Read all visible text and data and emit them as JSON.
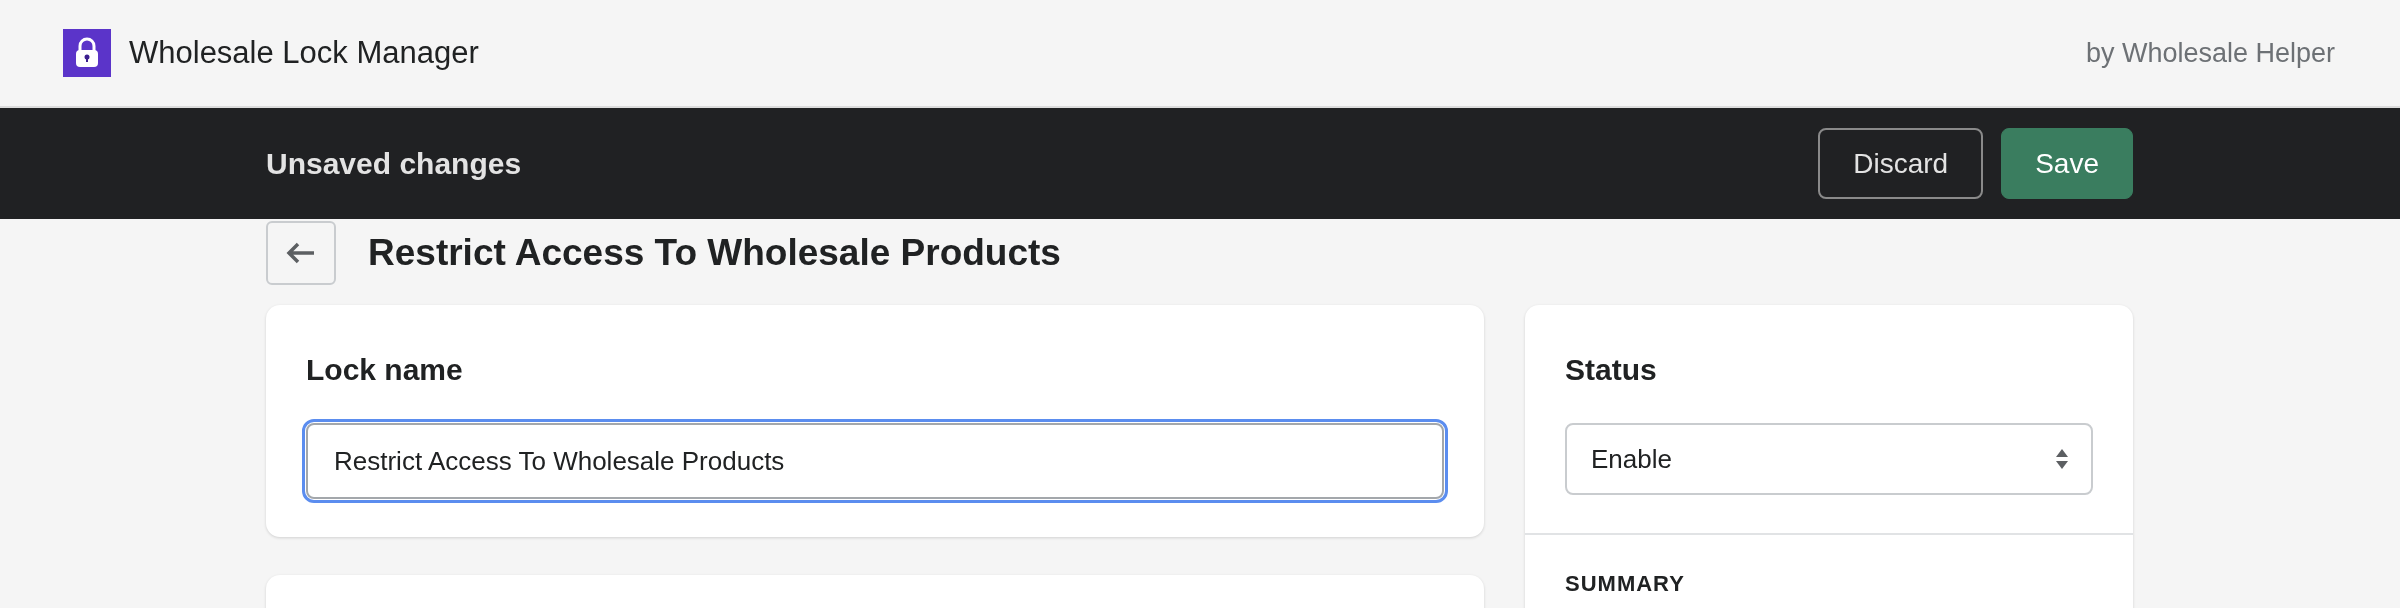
{
  "app_header": {
    "title": "Wholesale Lock Manager",
    "byline": "by Wholesale Helper"
  },
  "save_bar": {
    "message": "Unsaved changes",
    "buttons": [
      {
        "kind": "secondary",
        "label": "Discard"
      },
      {
        "kind": "primary",
        "label": "Save"
      }
    ]
  },
  "page": {
    "title": "Restrict Access To Wholesale Products"
  },
  "lock_name_card": {
    "heading": "Lock name",
    "field": {
      "value": "Restrict Access To Wholesale Products",
      "focused": true
    }
  },
  "status_card": {
    "heading": "Status",
    "select": {
      "value": "Enable"
    },
    "summary_heading": "SUMMARY"
  }
}
